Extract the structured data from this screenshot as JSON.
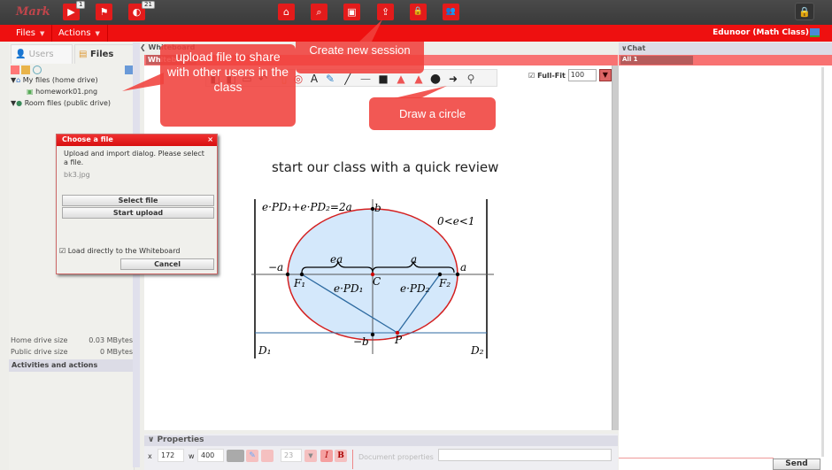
{
  "topbar": {
    "logo": "Mark",
    "buttons": [
      {
        "icon": "play-icon",
        "glyph": "▶",
        "badge": "1"
      },
      {
        "icon": "flag-icon",
        "glyph": "⚑",
        "badge": null
      },
      {
        "icon": "globe-icon",
        "glyph": "◐",
        "badge": "21"
      },
      {
        "icon": "home-icon",
        "glyph": "⌂",
        "badge": null
      },
      {
        "icon": "search-icon",
        "glyph": "⌕",
        "badge": null
      },
      {
        "icon": "whiteboard-icon",
        "glyph": "▣",
        "badge": null
      },
      {
        "icon": "share-icon",
        "glyph": "⇪",
        "badge": null
      },
      {
        "icon": "lock-icon",
        "glyph": "🔒",
        "badge": null
      },
      {
        "icon": "users-icon",
        "glyph": "👥",
        "badge": null
      }
    ],
    "right_lock_glyph": "🔒"
  },
  "menubar": {
    "files": "Files",
    "actions": "Actions",
    "caret": "▼",
    "room": "Edunoor (Math Class)"
  },
  "left": {
    "tabs": {
      "users": "Users",
      "files": "Files"
    },
    "tree": {
      "my_files": "My files (home drive)",
      "file1": "homework01.png",
      "room_files": "Room files (public drive)"
    },
    "sizes": {
      "home_label": "Home drive size",
      "home_value": "0.03 MBytes",
      "public_label": "Public drive size",
      "public_value": "0 MBytes"
    },
    "activities": "Activities and actions"
  },
  "whiteboard": {
    "header": "Whiteboard",
    "tab": "Whiteboard",
    "fullfit_label": "Full-Fit",
    "zoom": "100",
    "title": "start our class with a quick review",
    "tools": [
      "◧",
      "◧",
      "▭",
      "↶",
      "▯",
      "◎",
      "A",
      "✎",
      "╱",
      "—",
      "■",
      "▲",
      "▲",
      "●",
      "➜",
      "⚲"
    ]
  },
  "diagram": {
    "eq1": "e·PD₁+e·PD₂=2a",
    "ineq": "0<e<1",
    "b": "b",
    "minus_b": "−b",
    "minus_a": "−a",
    "a_right": "a",
    "ea": "ea",
    "a_top": "a",
    "F1": "F₁",
    "F2": "F₂",
    "C": "C",
    "P": "P",
    "ePD1": "e·PD₁",
    "ePD2": "e·PD₂",
    "D1": "D₁",
    "D2": "D₂"
  },
  "properties": {
    "header": "Properties",
    "x_label": "x",
    "x_value": "172",
    "w_label": "w",
    "w_value": "400",
    "font_size": "23",
    "italic": "I",
    "bold": "B",
    "doc_props": "Document properties"
  },
  "chat": {
    "header": "Chat",
    "tab": "All 1",
    "send": "Send"
  },
  "dialog": {
    "title": "Choose a file",
    "close": "×",
    "text": "Upload and import dialog. Please select a file.",
    "filename": "bk3.jpg",
    "select": "Select file",
    "start": "Start upload",
    "load_label": "Load directly to the Whiteboard",
    "cancel": "Cancel"
  },
  "callouts": {
    "upload": "upload file to share with other users in the class",
    "session": "Create new session",
    "circle": "Draw a circle"
  },
  "colors": {
    "accent": "#ee1010",
    "callout": "#f0413c",
    "ellipse_fill": "#d4e8fb",
    "ellipse_stroke": "#d42020",
    "segment": "#2d6aa0"
  }
}
